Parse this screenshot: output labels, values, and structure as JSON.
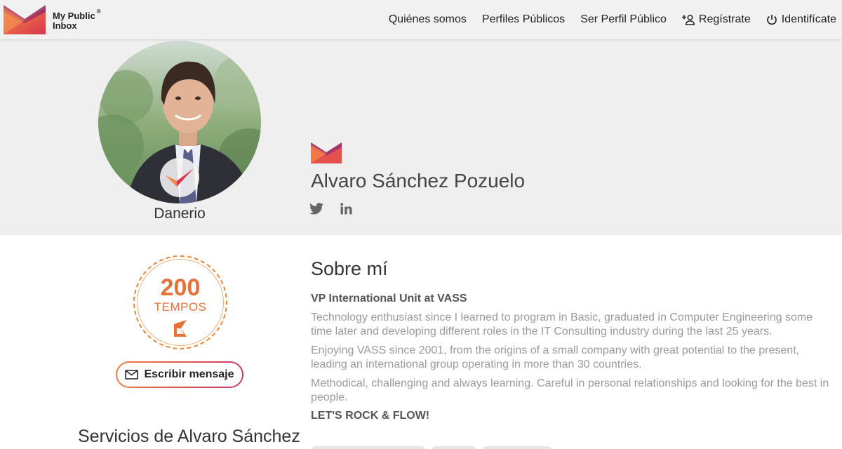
{
  "header": {
    "logo_line1": "My Public",
    "logo_line2": "Inbox",
    "logo_reg": "®",
    "nav": [
      {
        "label": "Quiénes somos",
        "icon": ""
      },
      {
        "label": "Perfiles Públicos",
        "icon": ""
      },
      {
        "label": "Ser Perfil Público",
        "icon": ""
      },
      {
        "label": "Regístrate",
        "icon": "add-user-icon"
      },
      {
        "label": "Identifícate",
        "icon": "power-icon"
      }
    ]
  },
  "profile": {
    "avatar_caption": "Danerio",
    "name": "Alvaro Sánchez Pozuelo",
    "socials": [
      "twitter-icon",
      "linkedin-icon"
    ]
  },
  "tempos": {
    "value": "200",
    "label": "TEMPOS"
  },
  "actions": {
    "message_label": "Escribir mensaje"
  },
  "about": {
    "title": "Sobre mí",
    "role": "VP International Unit at VASS",
    "paragraphs": [
      "Technology enthusiast since I learned to program in Basic, graduated in Computer Engineering some time later and developing different roles in the IT Consulting industry during the last 25 years.",
      "Enjoying VASS since 2001, from the origins of a small company with great potential to the present, leading an international group operating in more than 30 countries.",
      "Methodical, challenging and always learning. Careful in personal relationships and looking for the best in people."
    ],
    "motto": "LET'S ROCK & FLOW!"
  },
  "services": {
    "title": "Servicios de Alvaro Sánchez"
  },
  "colors": {
    "brand_orange": "#e8713a",
    "brand_red": "#d9354f",
    "brand_magenta": "#b23a6b",
    "header_bg": "#f1f1f1",
    "hero_bg": "#efefef"
  }
}
